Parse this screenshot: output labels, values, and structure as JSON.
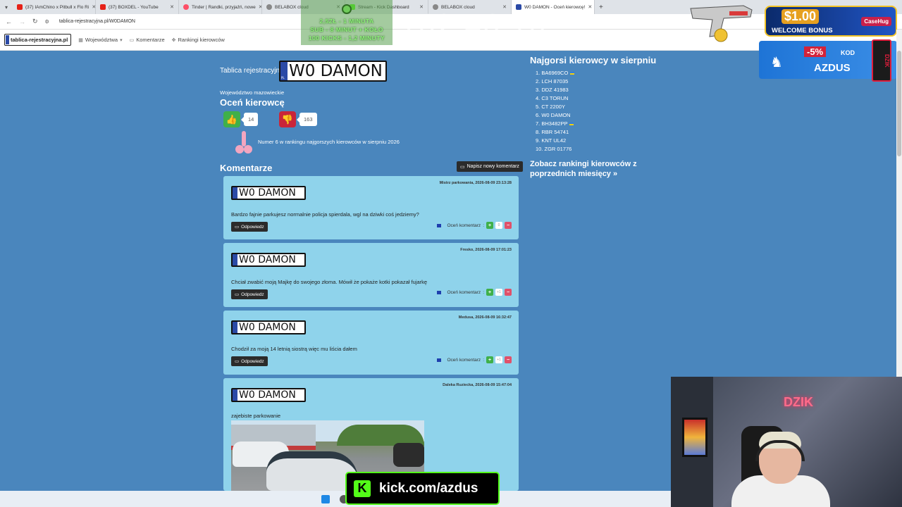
{
  "browser": {
    "tabs": [
      {
        "title": "(37) IAmChino x Pitbull x Flo Ri",
        "color": "#e62117"
      },
      {
        "title": "(37) BOXDEL - YouTube",
        "color": "#e62117"
      },
      {
        "title": "Tinder | Randki, przyjaźń, nowe",
        "color": "#fd5068"
      },
      {
        "title": "BELABOX cloud",
        "color": "#888888"
      },
      {
        "title": "Stream - Kick Dashboard",
        "color": "#53fc18"
      },
      {
        "title": "BELABOX cloud",
        "color": "#888888"
      },
      {
        "title": "W0 DAMON - Oceń kierowcę!",
        "color": "#2b4aa6"
      }
    ],
    "url": "tablica-rejestracyjna.pl/W0DAMON"
  },
  "site": {
    "logo": "tablica-rejestracyjna.pl",
    "nav": [
      "Województwa",
      "Komentarze",
      "Rankingi kierowców"
    ]
  },
  "overlay": {
    "stream_lines": [
      "2,5ZŁ - 1 MINUTA",
      "SUB - 8 MINUT + KOŁO",
      "100 KICKS - 1,2 MINUTY"
    ],
    "timer": "162:46:10",
    "bonus_amount": "$1.00",
    "bonus_text": "WELCOME BONUS",
    "bonus_brand": "CaseHug",
    "promo_pct": "-5%",
    "promo_kod": "KOD",
    "promo_code": "AZDUS",
    "kick_url": "kick.com/azdus"
  },
  "page": {
    "plate_label": "Tablica rejestracyjna",
    "plate": "W0 DAMON",
    "voivodeship": "Województwo mazowieckie",
    "rate_title": "Oceń kierowcę",
    "likes": "14",
    "dislikes": "163",
    "rank_text": "Numer 6 w rankingu najgorszych kierowców w sierpniu 2026",
    "comments_title": "Komentarze",
    "new_comment": "Napisz nowy komentarz",
    "reply_label": "Odpowiedz",
    "rate_comment_label": "Oceń komentarz",
    "comments": [
      {
        "date": "Mistrz parkowania, 2026-08-09 23:13:28",
        "text": "Bardzo fajnie parkujesz normalnie policja spierdala, wgl na dziwki coś jedziemy?",
        "score": "0"
      },
      {
        "date": "Fresko, 2026-08-09 17:01:23",
        "text": "Chciał zwabić moją Majkę do swojego złoma. Mówił że pokaże kotki pokazał fujarkę",
        "score": "+1"
      },
      {
        "date": "Medusa, 2026-08-09 16:32:47",
        "text": "Chodził za moją 14 letnią siostrą więc mu liścia dałem",
        "score": "+1"
      },
      {
        "date": "Daleka Ruziecka, 2026-08-09 15:47:04",
        "text": "zajebiste parkowanie",
        "score": ""
      }
    ]
  },
  "sidebar": {
    "title": "Najgorsi kierowcy w sierpniu",
    "items": [
      {
        "label": "1. BA6969CO",
        "ua": true
      },
      {
        "label": "2. LCH 87035",
        "ua": false
      },
      {
        "label": "3. DDZ 41983",
        "ua": false
      },
      {
        "label": "4. C3 TORUN",
        "ua": false
      },
      {
        "label": "5. CT 2200Y",
        "ua": false
      },
      {
        "label": "6. W0 DAMON",
        "ua": false
      },
      {
        "label": "7. BH3482PP",
        "ua": true
      },
      {
        "label": "8. RBR 54741",
        "ua": false
      },
      {
        "label": "9. KNT UL42",
        "ua": false
      },
      {
        "label": "10. ZGR 01776",
        "ua": false
      }
    ],
    "more": "Zobacz rankingi kierowców z poprzednich miesięcy »"
  },
  "webcam": {
    "neon": "DZIK"
  }
}
